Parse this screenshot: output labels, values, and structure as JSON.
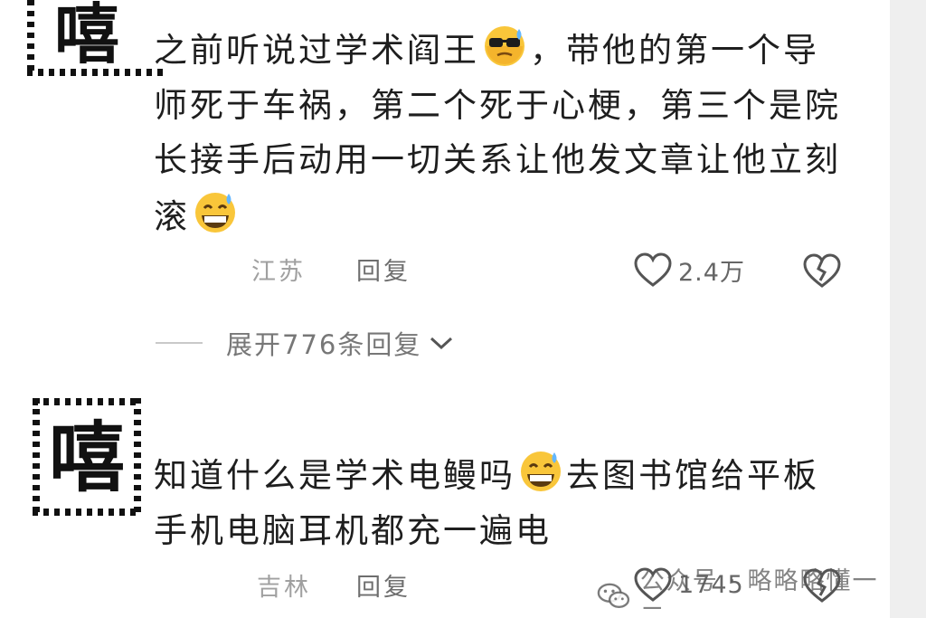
{
  "comments": [
    {
      "avatar_char": "嘻",
      "text_part1": "之前听说过学术阎王",
      "emoji1": "sunglasses-sweat-emoji",
      "text_part2": "，带他的第一个导师死于车祸，第二个死于心梗，第三个是院长接手后动用一切关系让他发文章让他立刻滚",
      "emoji2": "grinning-sweat-emoji",
      "location": "江苏",
      "reply_label": "回复",
      "like_count": "2.4万",
      "expand_label": "展开776条回复"
    },
    {
      "avatar_char": "嘻",
      "text_part1": "知道什么是学术电鳗吗",
      "emoji1": "grinning-sweat-emoji",
      "text_part2": "去图书馆给平板手机电脑耳机都充一遍电",
      "location": "吉林",
      "reply_label": "回复",
      "like_count": "1745"
    }
  ],
  "watermark": {
    "text": "公众号 · 略略略懂一二",
    "icon": "wechat-icon"
  },
  "colors": {
    "text": "#1e1e1e",
    "meta": "#a0a0a0",
    "icon": "#555555"
  }
}
